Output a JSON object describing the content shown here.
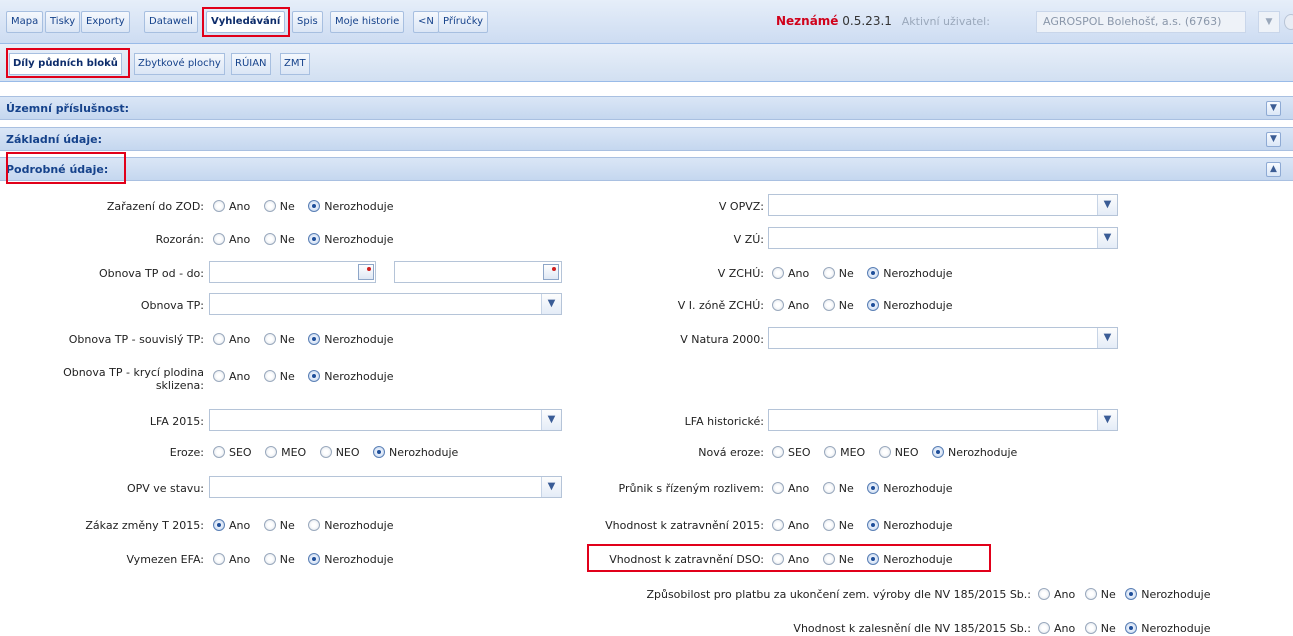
{
  "toolbar": {
    "tabs": [
      "Mapa",
      "Tisky",
      "Exporty",
      "Datawell",
      "Vyhledávání",
      "Spis",
      "Moje historie",
      "<N",
      "Příručky"
    ],
    "status_warning": "Neznámé",
    "version": "0.5.23.1",
    "active_user_label": "Aktivní uživatel:",
    "active_user_value": "AGROSPOL Bolehošť, a.s. (6763)"
  },
  "subtabs": [
    "Díly půdních bloků",
    "Zbytkové plochy",
    "RÚIAN",
    "ZMT"
  ],
  "sections": {
    "territorial": "Územní příslušnost:",
    "basic": "Základní údaje:",
    "detailed": "Podrobné údaje:"
  },
  "options": {
    "yes": "Ano",
    "no": "Ne",
    "any": "Nerozhoduje",
    "seo": "SEO",
    "meo": "MEO",
    "neo": "NEO"
  },
  "left": {
    "zod": "Zařazení do ZOD:",
    "rozoran": "Rozorán:",
    "obnova_od_do": "Obnova TP od - do:",
    "obnova_tp": "Obnova TP:",
    "obnova_souvisly": "Obnova TP - souvislý TP:",
    "obnova_kryci_1": "Obnova TP - krycí plodina",
    "obnova_kryci_2": "sklizena:",
    "lfa2015": "LFA 2015:",
    "eroze": "Eroze:",
    "opv": "OPV ve stavu:",
    "zakaz": "Zákaz změny T 2015:",
    "efa": "Vymezen EFA:"
  },
  "right": {
    "opvz": "V OPVZ:",
    "zu": "V ZÚ:",
    "zchu": "V ZCHÚ:",
    "zchu1": "V I. zóně ZCHÚ:",
    "natura": "V Natura 2000:",
    "lfa_hist": "LFA historické:",
    "nova_eroze": "Nová eroze:",
    "prunik": "Průnik s řízeným rozlivem:",
    "zatr2015": "Vhodnost k zatravnění 2015:",
    "zatr_dso": "Vhodnost k zatravnění DSO:",
    "zpusobilost": "Způsobilost pro platbu za ukončení zem. výroby dle NV 185/2015 Sb.:",
    "zalesneni": "Vhodnost k zalesnění dle NV 185/2015 Sb.:"
  }
}
